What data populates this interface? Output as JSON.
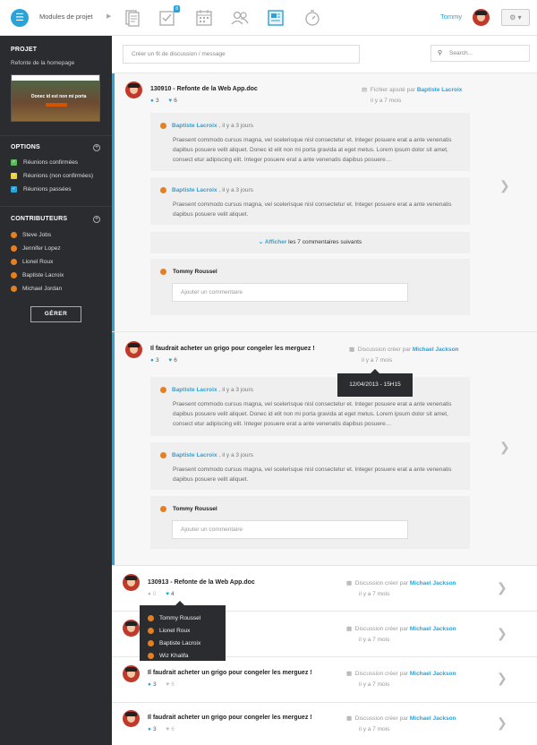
{
  "topbar": {
    "modules_label": "Modules de projet",
    "badge_count": "8",
    "user_name": "Tommy",
    "icons": [
      "docs-icon",
      "checklist-icon",
      "calendar-icon",
      "users-icon",
      "discussion-icon",
      "timer-icon"
    ]
  },
  "sidebar": {
    "project_title": "PROJET",
    "project_name": "Refonte de la homepage",
    "thumb_text": "Donec id est non mi porta",
    "options_title": "OPTIONS",
    "options": [
      {
        "label": "Réunions confirmées",
        "color": "#5cb85c"
      },
      {
        "label": "Réunions (non confirmées)",
        "color": "#e8d33f"
      },
      {
        "label": "Réunions passées",
        "color": "#2aa3d8"
      }
    ],
    "contributors_title": "CONTRIBUTEURS",
    "contributors": [
      "Steve Jobs",
      "Jennifer Lopez",
      "Lionel Roux",
      "Baptiste Lacroix",
      "Michael Jordan"
    ],
    "manage_label": "GÉRER"
  },
  "main": {
    "compose_placeholder": "Créer un fil de discussion / message",
    "search_placeholder": "Search...",
    "lorem_long": "Praesent commodo cursus magna, vel scelerisque nisl consectetur et. Integer posuere erat a ante venenatis dapibus posuere velit aliquet. Donec id elit non mi porta gravida at eget metus. Lorem ipsum dolor sit amet, consect etur adipiscing elit. Integer posuere erat a ante venenatis dapibus posuere…",
    "lorem_short": "Praesent commodo cursus magna, vel scelerisque nisl consectetur et. Integer posuere erat a ante venenatis dapibus posuere velit aliquet.",
    "comment_author": "Baptiste Lacroix",
    "comment_time": ", il y a 3 jours",
    "show_more_link": "Afficher",
    "show_more_rest": " les 7 commentaires suivants",
    "reply_author": "Tommy Roussel",
    "reply_placeholder": "Ajouter un commentaire",
    "threads": [
      {
        "title": "130910 - Refonte de la Web App.doc",
        "comments": "3",
        "likes": "6",
        "meta_prefix": "Fichier ajouté par ",
        "meta_who": "Baptiste Lacroix",
        "time": "il y a 7 mois"
      },
      {
        "title": "Il faudrait acheter un grigo pour congeler les merguez !",
        "comments": "3",
        "likes": "6",
        "meta_prefix": "Discussion créer par ",
        "meta_who": "Michael Jackson",
        "time": "il y a 7 mois"
      },
      {
        "title": "130913 - Refonte de la Web App.doc",
        "comments": "0",
        "likes": "4",
        "meta_prefix": "Discussion créer par ",
        "meta_who": "Michael Jackson",
        "time": "il y a 7 mois"
      },
      {
        "title": "",
        "comments": "",
        "likes": "",
        "meta_prefix": "Discussion créer par ",
        "meta_who": "Michael Jackson",
        "time": "il y a 7 mois"
      },
      {
        "title": "Il faudrait acheter un grigo pour congeler les merguez !",
        "comments": "3",
        "likes": "6",
        "meta_prefix": "Discussion créer par ",
        "meta_who": "Michael Jackson",
        "time": "il y a 7 mois"
      },
      {
        "title": "Il faudrait acheter un grigo pour congeler les merguez !",
        "comments": "3",
        "likes": "6",
        "meta_prefix": "Discussion créer par ",
        "meta_who": "Michael Jackson",
        "time": "il y a 7 mois"
      }
    ],
    "tooltip_date": "12/04/2013 - 15H15",
    "likers": [
      "Tommy Roussel",
      "Lionel Roux",
      "Baptiste Lacroix",
      "Wiz Khalifa"
    ]
  }
}
